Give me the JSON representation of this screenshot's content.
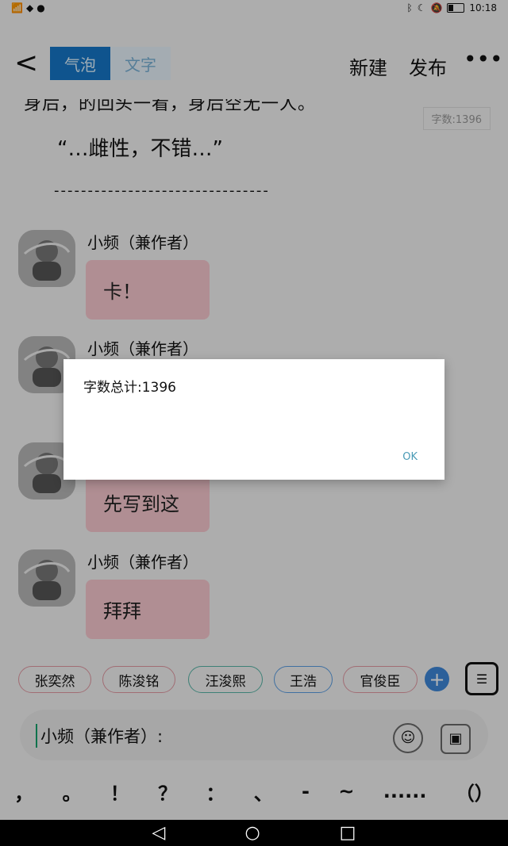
{
  "status": {
    "time": "10:18",
    "left_icons": [
      "wifi-icon",
      "app-icon",
      "wechat-icon"
    ],
    "right_icons": [
      "bluetooth-icon",
      "moon-icon",
      "mute-icon",
      "battery-icon"
    ]
  },
  "toolbar": {
    "back_icon": "back-icon",
    "tabs": [
      "气泡",
      "文字"
    ],
    "new_label": "新建",
    "publish_label": "发布",
    "more_icon": "more-icon"
  },
  "story": {
    "top_line": "身后，的回头一看，身后空无一人。",
    "wordcount_badge": "字数:1396",
    "quote": "“…雌性，不错…”",
    "separator": "--------------------------------"
  },
  "messages": [
    {
      "name": "小频（兼作者）",
      "text": "卡！"
    },
    {
      "name": "小频（兼作者）",
      "text": ""
    },
    {
      "name": "",
      "text": "先写到这"
    },
    {
      "name": "小频（兼作者）",
      "text": "拜拜"
    }
  ],
  "tags": [
    "张奕然",
    "陈浚铭",
    "汪浚熙",
    "王浩",
    "官俊臣"
  ],
  "input": {
    "value": "小频（兼作者）:"
  },
  "punctuation": [
    "，",
    "。",
    "！",
    "？",
    "：",
    "、",
    "-",
    "~",
    "......",
    "（）"
  ],
  "dialog": {
    "message": "字数总计:1396",
    "ok_label": "OK"
  },
  "nav": [
    "◁",
    "○",
    "□"
  ]
}
